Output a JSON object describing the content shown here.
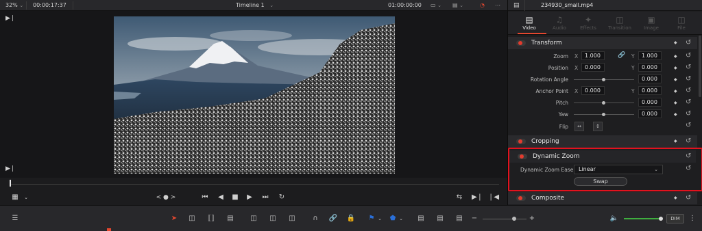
{
  "viewer_bar": {
    "zoom": "32%",
    "timecode_left": "00:00:17:37",
    "timeline_name": "Timeline 1",
    "timecode_right": "01:00:00:00"
  },
  "inspector": {
    "clip_name": "234930_small.mp4",
    "tabs": [
      {
        "label": "Video",
        "icon": "film-icon",
        "active": true
      },
      {
        "label": "Audio",
        "icon": "music-note-icon",
        "active": false
      },
      {
        "label": "Effects",
        "icon": "magic-wand-icon",
        "active": false
      },
      {
        "label": "Transition",
        "icon": "transition-icon",
        "active": false
      },
      {
        "label": "Image",
        "icon": "image-icon",
        "active": false
      },
      {
        "label": "File",
        "icon": "file-icon",
        "active": false
      }
    ],
    "transform": {
      "title": "Transform",
      "zoom": {
        "label": "Zoom",
        "x_axis": "X",
        "x": "1.000",
        "y_axis": "Y",
        "y": "1.000"
      },
      "position": {
        "label": "Position",
        "x_axis": "X",
        "x": "0.000",
        "y_axis": "Y",
        "y": "0.000"
      },
      "rotation": {
        "label": "Rotation Angle",
        "value": "0.000"
      },
      "anchor": {
        "label": "Anchor Point",
        "x_axis": "X",
        "x": "0.000",
        "y_axis": "Y",
        "y": "0.000"
      },
      "pitch": {
        "label": "Pitch",
        "value": "0.000"
      },
      "yaw": {
        "label": "Yaw",
        "value": "0.000"
      },
      "flip": {
        "label": "Flip"
      }
    },
    "cropping": {
      "title": "Cropping"
    },
    "dynamic_zoom": {
      "title": "Dynamic Zoom",
      "ease_label": "Dynamic Zoom Ease",
      "ease_value": "Linear",
      "swap_label": "Swap"
    },
    "composite": {
      "title": "Composite"
    }
  },
  "toolbar": {
    "dim_label": "DIM"
  },
  "colors": {
    "accent_red": "#e4472f",
    "highlight_box": "#e3121e",
    "volume_green": "#3fae3f",
    "flag_blue": "#2a6fd8"
  }
}
